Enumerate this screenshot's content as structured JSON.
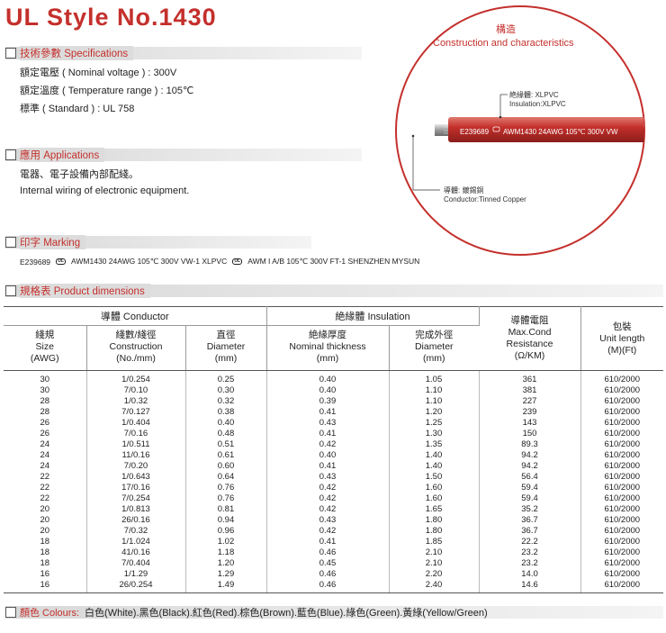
{
  "title": "UL Style No.1430",
  "sections": {
    "specs": "技術參數 Specifications",
    "applications": "應用 Applications",
    "marking": "印字 Marking",
    "dimensions": "規格表 Product  dimensions",
    "colours": "顏色 Colours:"
  },
  "specs": {
    "voltage": "額定電壓 ( Nominal voltage ) : 300V",
    "temperature": "額定溫度 ( Temperature range ) : 105℃",
    "standard": "標準 ( Standard ) : UL 758"
  },
  "applications": {
    "zh": "電器、電子設備內部配綫。",
    "en": "Internal wiring of electronic equipment."
  },
  "marking": {
    "part1": "E239689",
    "part2": "AWM1430 24AWG 105℃ 300V VW-1 XLPVC",
    "part3": "AWM I A/B 105℃ 300V FT-1 SHENZHEN MYSUN"
  },
  "illustration": {
    "title_zh": "構造",
    "title_en": "Construction  and  characteristics",
    "insulation_zh": "絶緣體: XLPVC",
    "insulation_en": "Insulation:XLPVC",
    "conductor_zh": "導體: 鍍錫銅",
    "conductor_en": "Conductor:Tinned Copper",
    "cable_print1": "E239689",
    "cable_print2": "AWM1430 24AWG 105℃ 300V VW"
  },
  "table": {
    "group_conductor": "導體 Conductor",
    "group_insulation": "絶緣體  Insulation",
    "col_size": [
      "綫規",
      "Size",
      "(AWG)"
    ],
    "col_construction": [
      "綫數/綫徑",
      "Construction",
      "(No./mm)"
    ],
    "col_cdiameter": [
      "直徑",
      "Diameter",
      "(mm)"
    ],
    "col_thickness": [
      "絶緣厚度",
      "Nominal thickness",
      "(mm)"
    ],
    "col_odiameter": [
      "完成外徑",
      "Diameter",
      "(mm)"
    ],
    "col_resistance": [
      "導體電阻",
      "Max.Cond",
      "Resistance",
      "(Ω/KM)"
    ],
    "col_package": [
      "包裝",
      "Unit  length",
      "(M)(Ft)"
    ],
    "rows": [
      [
        "30",
        "1/0.254",
        "0.25",
        "0.40",
        "1.05",
        "361",
        "610/2000"
      ],
      [
        "30",
        "7/0.10",
        "0.30",
        "0.40",
        "1.10",
        "381",
        "610/2000"
      ],
      [
        "28",
        "1/0.32",
        "0.32",
        "0.39",
        "1.10",
        "227",
        "610/2000"
      ],
      [
        "28",
        "7/0.127",
        "0.38",
        "0.41",
        "1.20",
        "239",
        "610/2000"
      ],
      [
        "26",
        "1/0.404",
        "0.40",
        "0.43",
        "1.25",
        "143",
        "610/2000"
      ],
      [
        "26",
        "7/0.16",
        "0.48",
        "0.41",
        "1.30",
        "150",
        "610/2000"
      ],
      [
        "24",
        "1/0.511",
        "0.51",
        "0.42",
        "1.35",
        "89.3",
        "610/2000"
      ],
      [
        "24",
        "11/0.16",
        "0.61",
        "0.40",
        "1.40",
        "94.2",
        "610/2000"
      ],
      [
        "24",
        "7/0.20",
        "0.60",
        "0.41",
        "1.40",
        "94.2",
        "610/2000"
      ],
      [
        "22",
        "1/0.643",
        "0.64",
        "0.43",
        "1.50",
        "56.4",
        "610/2000"
      ],
      [
        "22",
        "17/0.16",
        "0.76",
        "0.42",
        "1.60",
        "59.4",
        "610/2000"
      ],
      [
        "22",
        "7/0.254",
        "0.76",
        "0.42",
        "1.60",
        "59.4",
        "610/2000"
      ],
      [
        "20",
        "1/0.813",
        "0.81",
        "0.42",
        "1.65",
        "35.2",
        "610/2000"
      ],
      [
        "20",
        "26/0.16",
        "0.94",
        "0.43",
        "1.80",
        "36.7",
        "610/2000"
      ],
      [
        "20",
        "7/0.32",
        "0.96",
        "0.42",
        "1.80",
        "36.7",
        "610/2000"
      ],
      [
        "18",
        "1/1.024",
        "1.02",
        "0.41",
        "1.85",
        "22.2",
        "610/2000"
      ],
      [
        "18",
        "41/0.16",
        "1.18",
        "0.46",
        "2.10",
        "23.2",
        "610/2000"
      ],
      [
        "18",
        "7/0.404",
        "1.20",
        "0.45",
        "2.10",
        "23.2",
        "610/2000"
      ],
      [
        "16",
        "1/1.29",
        "1.29",
        "0.46",
        "2.20",
        "14.0",
        "610/2000"
      ],
      [
        "16",
        "26/0.254",
        "1.49",
        "0.46",
        "2.40",
        "14.6",
        "610/2000"
      ]
    ]
  },
  "colours": "白色(White).黑色(Black).紅色(Red).棕色(Brown).藍色(Blue).綠色(Green).黃綠(Yellow/Green)",
  "accent_color": "#c4302c"
}
